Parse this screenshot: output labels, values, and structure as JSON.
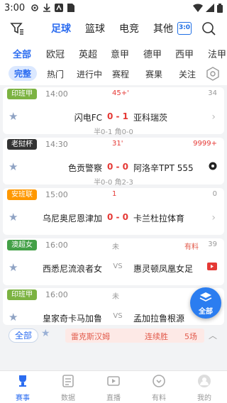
{
  "status_bar": {
    "time": "3:00"
  },
  "top_nav": {
    "tabs": [
      "足球",
      "篮球",
      "电竞",
      "其他"
    ],
    "active_tab": 0,
    "score_icon_text": "3:0"
  },
  "leagues": [
    "全部",
    "欧冠",
    "英超",
    "意甲",
    "德甲",
    "西甲",
    "法甲"
  ],
  "filters": [
    "完整",
    "热门",
    "进行中",
    "赛程",
    "赛果",
    "关注"
  ],
  "matches": [
    {
      "league": "印班甲",
      "league_color": "#7cb342",
      "time": "14:00",
      "status": "45+'",
      "count": "34",
      "home": "闪电FC",
      "score_home": "0",
      "score_away": "1",
      "away": "亚科瑞茨",
      "sub": "半0-1 角0-0"
    },
    {
      "league": "老挝杯",
      "league_color": "#333333",
      "time": "14:30",
      "status": "31'",
      "count": "9999+",
      "home": "色贡警察",
      "score_home": "0",
      "score_away": "0",
      "away": "阿洛辛TPT 555",
      "sub": "半0-0 角2-3"
    },
    {
      "league": "安班联",
      "league_color": "#ff9800",
      "time": "15:00",
      "status": "1",
      "count": "0",
      "home": "乌尼奥尼恩津加",
      "score_home": "0",
      "score_away": "0",
      "away": "卡兰杜拉体育",
      "sub": ""
    },
    {
      "league": "澳超女",
      "league_color": "#43a047",
      "time": "16:00",
      "status": "未",
      "count": "39",
      "tip": "有料",
      "home": "西悉尼流浪者女",
      "vs": "VS",
      "away": "惠灵顿凤凰女足",
      "sub": ""
    },
    {
      "league": "印班甲",
      "league_color": "#7cb342",
      "time": "16:00",
      "status": "未",
      "count": "",
      "home": "皇家奇卡马加鲁",
      "vs": "VS",
      "away": "孟加拉鲁根源",
      "sub": ""
    }
  ],
  "floating_button": {
    "label": "全部"
  },
  "streak": {
    "all_label": "全部",
    "team": "雷克斯汉姆",
    "label": "连续胜",
    "count": "5场"
  },
  "bottom_tabs": [
    "赛事",
    "数据",
    "直播",
    "有料",
    "我的"
  ]
}
